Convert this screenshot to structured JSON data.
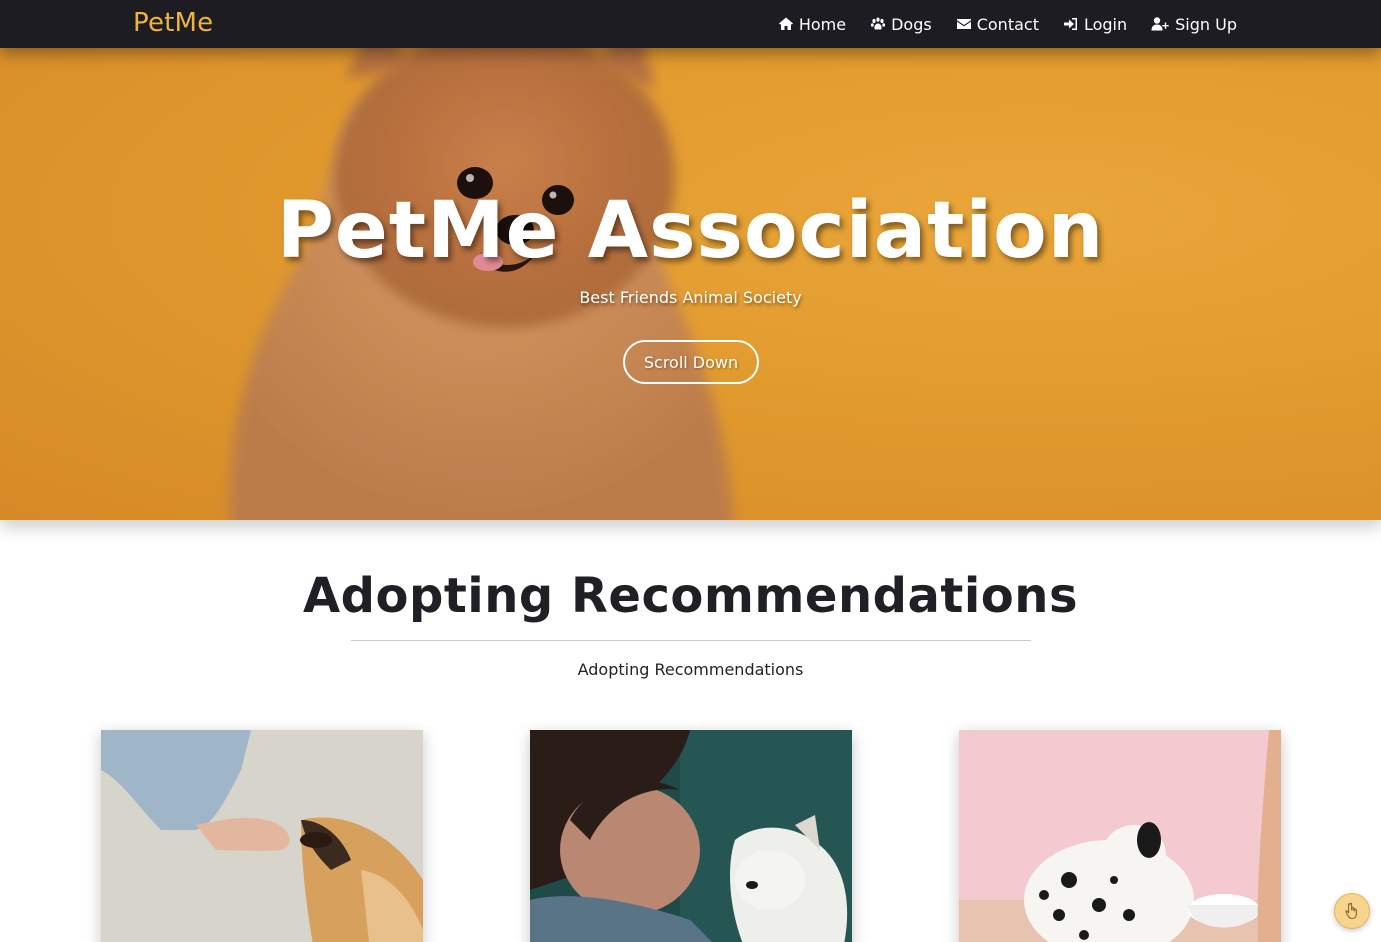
{
  "navbar": {
    "brand": "PetMe",
    "links": [
      {
        "label": "Home",
        "icon": "home-icon"
      },
      {
        "label": "Dogs",
        "icon": "paw-icon"
      },
      {
        "label": "Contact",
        "icon": "envelope-icon"
      },
      {
        "label": "Login",
        "icon": "sign-in-icon"
      },
      {
        "label": "Sign Up",
        "icon": "user-plus-icon"
      }
    ]
  },
  "hero": {
    "title": "PetMe Association",
    "subtitle": "Best Friends Animal Society",
    "button_label": "Scroll Down"
  },
  "section": {
    "title": "Adopting Recommendations",
    "subtitle": "Adopting Recommendations",
    "cards": [
      {
        "image": "hand-feeding-dog-photo"
      },
      {
        "image": "woman-with-white-dog-photo"
      },
      {
        "image": "dalmatian-puppy-bowl-photo"
      }
    ]
  },
  "floating_button": {
    "icon": "hand-pointer-icon"
  },
  "colors": {
    "navbar_bg": "#1c1c22",
    "brand": "#f0b43a",
    "hero_bg": "#e19a2e",
    "text_dark": "#1f1f24"
  }
}
